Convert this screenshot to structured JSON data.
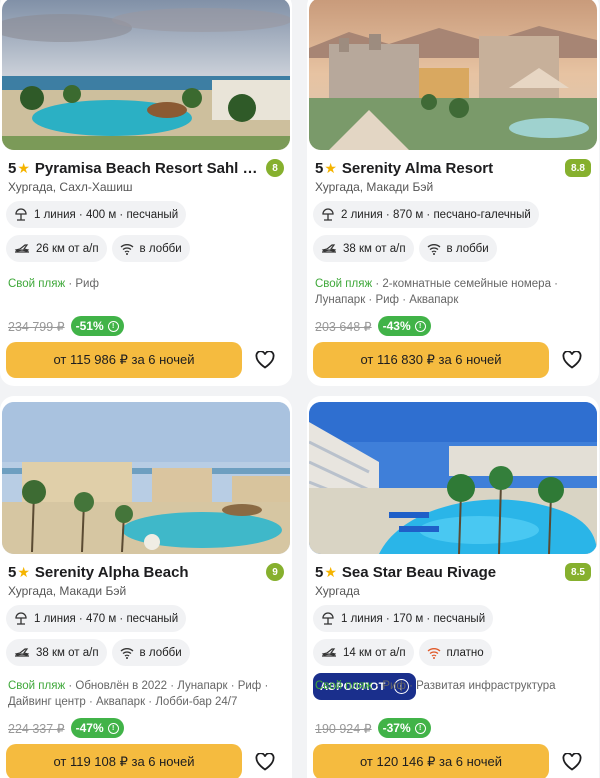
{
  "cards": [
    {
      "stars": "5",
      "name": "Pyramisa Beach Resort Sahl Ha...",
      "rating": "8",
      "location": "Хургада, Сахл-Хашиш",
      "beach": "1 линия · 400 м · песчаный",
      "airport": "26 км от а/п",
      "wifi": "в лобби",
      "tag_green": "Свой пляж",
      "tags_rest": " · Риф",
      "old_price": "234 799 ₽",
      "discount": "-51%",
      "buy_label": "от 115 986 ₽ за 6 ночей"
    },
    {
      "stars": "5",
      "name": "Serenity Alma Resort",
      "rating": "8.8",
      "location": "Хургада, Макади Бэй",
      "beach": "2 линия · 870 м · песчано-галечный",
      "airport": "38 км от а/п",
      "wifi": "в лобби",
      "tag_green": "Свой пляж",
      "tags_rest": " · 2-комнатные семейные номера · Лунапарк · Риф · Аквапарк",
      "old_price": "203 648 ₽",
      "discount": "-43%",
      "buy_label": "от 116 830 ₽ за 6 ночей"
    },
    {
      "stars": "5",
      "name": "Serenity Alpha Beach",
      "rating": "9",
      "location": "Хургада, Макади Бэй",
      "beach": "1 линия · 470 м · песчаный",
      "airport": "38 км от а/п",
      "wifi": "в лобби",
      "tag_green": "Свой пляж",
      "tags_rest": " · Обновлён в 2022 · Лунапарк · Риф · Дайвинг центр · Аквапарк · Лобби-бар 24/7",
      "old_price": "224 337 ₽",
      "discount": "-47%",
      "buy_label": "от 119 108 ₽ за 6 ночей"
    },
    {
      "stars": "5",
      "name": "Sea Star Beau Rivage",
      "rating": "8.5",
      "location": "Хургада",
      "beach": "1 линия · 170 м · песчаный",
      "airport": "14 км от а/п",
      "wifi": "платно",
      "airline": "АЭРОФЛОТ",
      "tag_green": "Свой пляж",
      "tags_rest": " · Риф · Развитая инфраструктура",
      "old_price": "190 924 ₽",
      "discount": "-37%",
      "buy_label": "от 120 146 ₽ за 6 ночей"
    }
  ],
  "colors": {
    "accent_button": "#f5bb3f",
    "discount_badge": "#41b348",
    "rating_badge": "#86b02e",
    "green_tag": "#3fa83a",
    "star": "#f5b400",
    "airline_brand": "#1a2f8c"
  },
  "icons": [
    "star-icon",
    "beach-icon",
    "plane-icon",
    "wifi-icon",
    "info-icon",
    "heart-icon"
  ]
}
